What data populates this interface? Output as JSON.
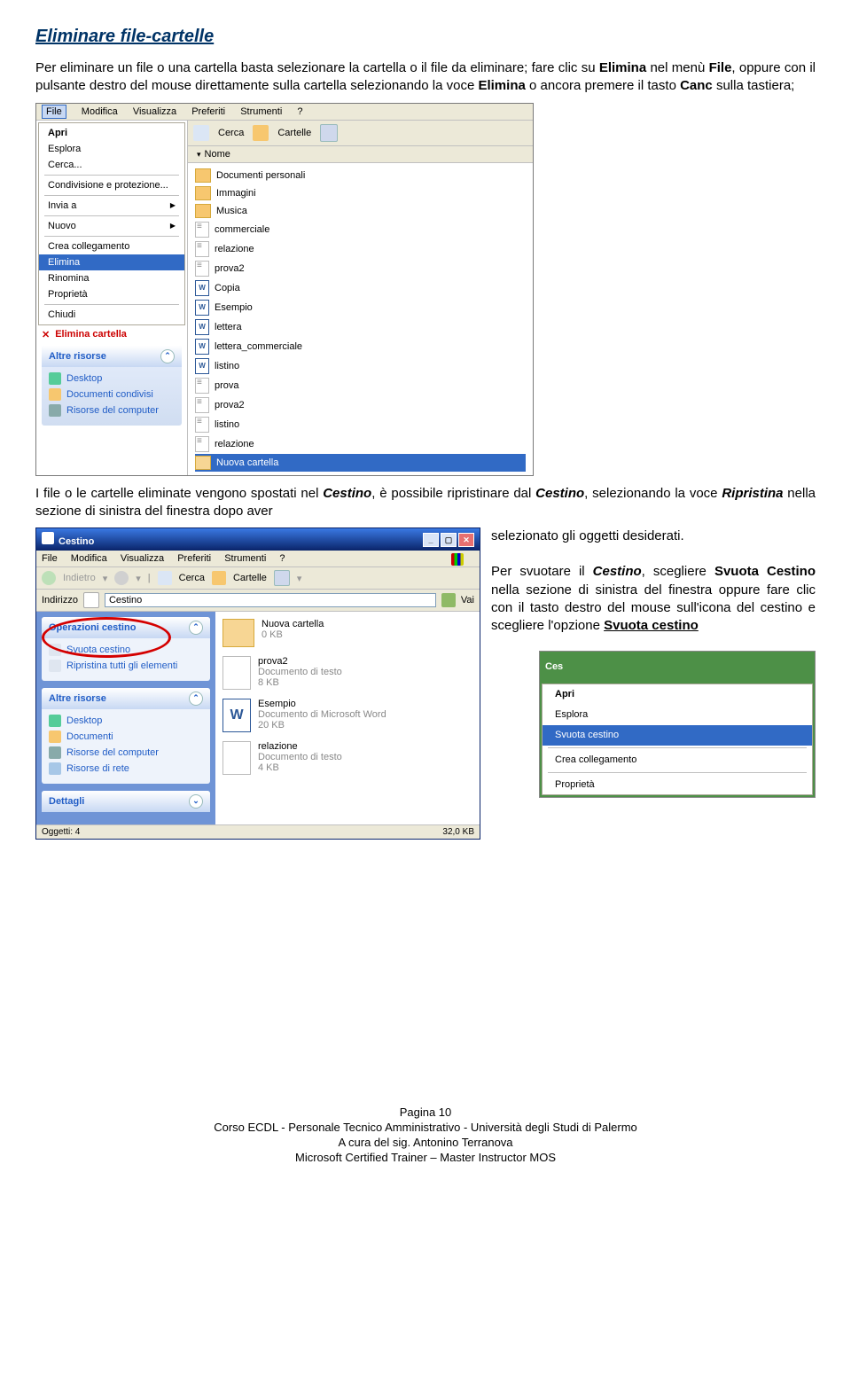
{
  "title": "Eliminare file-cartelle",
  "para1_a": "Per eliminare un file o una cartella basta selezionare la cartella o il file da eliminare; fare clic su ",
  "para1_b": "Elimina",
  "para1_c": " nel menù ",
  "para1_d": "File",
  "para1_e": ", oppure con il pulsante destro del mouse direttamente sulla cartella selezionando la voce ",
  "para1_f": "Elimina",
  "para1_g": " o ancora premere il tasto ",
  "para1_h": "Canc",
  "para1_i": " sulla tastiera;",
  "ss1": {
    "menubar": [
      "File",
      "Modifica",
      "Visualizza",
      "Preferiti",
      "Strumenti",
      "?"
    ],
    "filemenu": [
      "Apri",
      "Esplora",
      "Cerca...",
      "Condivisione e protezione...",
      "Invia a",
      "Nuovo",
      "Crea collegamento",
      "Elimina",
      "Rinomina",
      "Proprietà",
      "Chiudi"
    ],
    "eliminacartella": "Elimina cartella",
    "panel_title": "Altre risorse",
    "panel_items": [
      "Desktop",
      "Documenti condivisi",
      "Risorse del computer"
    ],
    "toolbar": {
      "cerca": "Cerca",
      "cartelle": "Cartelle"
    },
    "colhead": "Nome",
    "list": [
      {
        "ic": "sys",
        "t": "Documenti personali"
      },
      {
        "ic": "sys",
        "t": "Immagini"
      },
      {
        "ic": "sys",
        "t": "Musica"
      },
      {
        "ic": "txt",
        "t": "commerciale"
      },
      {
        "ic": "txt",
        "t": "relazione"
      },
      {
        "ic": "txt",
        "t": "prova2"
      },
      {
        "ic": "w",
        "t": "Copia"
      },
      {
        "ic": "w",
        "t": "Esempio"
      },
      {
        "ic": "w",
        "t": "lettera"
      },
      {
        "ic": "w",
        "t": "lettera_commerciale"
      },
      {
        "ic": "w",
        "t": "listino"
      },
      {
        "ic": "txt",
        "t": "prova"
      },
      {
        "ic": "txt",
        "t": "prova2"
      },
      {
        "ic": "txt",
        "t": "listino"
      },
      {
        "ic": "txt",
        "t": "relazione"
      },
      {
        "ic": "fold",
        "t": "Nuova cartella"
      }
    ]
  },
  "para2_a": "I file o le cartelle eliminate vengono spostati nel ",
  "para2_b": "Cestino",
  "para2_c": ", è possibile ripristinare dal ",
  "para2_d": "Cestino",
  "para2_e": ", selezionando la voce ",
  "para2_f": "Ripristina",
  "para2_g": " nella sezione di sinistra del finestra dopo aver selezionato gli oggetti desiderati.",
  "right_selected_txt": "selezionato gli oggetti desiderati.",
  "ss2": {
    "title": "Cestino",
    "menubar": [
      "File",
      "Modifica",
      "Visualizza",
      "Preferiti",
      "Strumenti",
      "?"
    ],
    "tb": {
      "back": "Indietro",
      "cerca": "Cerca",
      "cartelle": "Cartelle"
    },
    "addr_label": "Indirizzo",
    "addr_value": "Cestino",
    "vai": "Vai",
    "panel1_title": "Operazioni cestino",
    "panel1_items": [
      "Svuota cestino",
      "Ripristina tutti gli elementi"
    ],
    "panel2_title": "Altre risorse",
    "panel2_items": [
      "Desktop",
      "Documenti",
      "Risorse del computer",
      "Risorse di rete"
    ],
    "panel3_title": "Dettagli",
    "files": [
      {
        "ic": "fold",
        "name": "Nuova cartella",
        "sub": "0 KB"
      },
      {
        "ic": "txt",
        "name": "prova2",
        "sub": "Documento di testo\n8 KB"
      },
      {
        "ic": "word",
        "name": "Esempio",
        "sub": "Documento di Microsoft Word\n20 KB"
      },
      {
        "ic": "txt",
        "name": "relazione",
        "sub": "Documento di testo\n4 KB"
      }
    ],
    "status_left": "Oggetti: 4",
    "status_right": "32,0 KB"
  },
  "para3_a": "Per svuotare il ",
  "para3_b": "Cestino",
  "para3_c": ", scegliere ",
  "para3_d": "Svuota Cestino",
  "para3_e": " nella sezione di sinistra del finestra oppure fare clic con il tasto destro del mouse sull'icona del cestino e scegliere l'opzione ",
  "para3_f": "Svuota cestino",
  "ss3": {
    "items": [
      "Apri",
      "Esplora",
      "Svuota cestino",
      "Crea collegamento",
      "Proprietà"
    ]
  },
  "footer": {
    "l1": "Pagina 10",
    "l2": "Corso ECDL - Personale Tecnico Amministrativo - Università degli Studi di Palermo",
    "l3": "A cura del sig. Antonino Terranova",
    "l4": "Microsoft Certified Trainer – Master Instructor MOS"
  }
}
